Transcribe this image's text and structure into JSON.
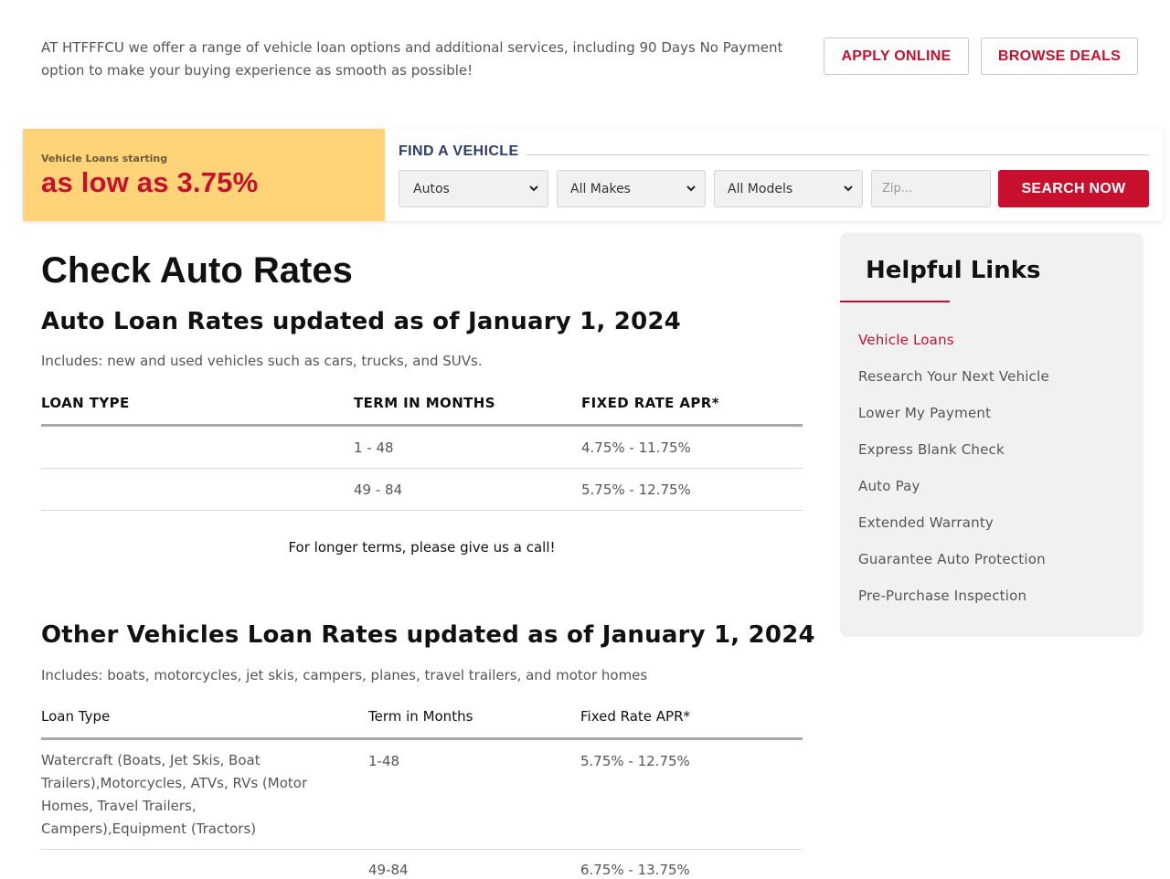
{
  "intro": {
    "text": "AT HTFFFCU we offer a range of vehicle loan options and additional services, including 90 Days No Payment option to make your buying experience as smooth as possible!",
    "apply_label": "APPLY ONLINE",
    "browse_label": "BROWSE DEALS"
  },
  "finder": {
    "promo_small": "Vehicle Loans starting",
    "promo_big": "as low as 3.75%",
    "title": "FIND A VEHICLE",
    "type_value": "Autos",
    "make_value": "All Makes",
    "model_value": "All Models",
    "zip_placeholder": "Zip...",
    "search_label": "SEARCH NOW"
  },
  "main": {
    "page_title": "Check Auto Rates",
    "auto": {
      "heading": "Auto Loan Rates updated as of January 1, 2024",
      "includes": "Includes: new and used vehicles such as cars, trucks, and SUVs.",
      "headers": [
        "LOAN TYPE",
        "TERM IN MONTHS",
        "FIXED RATE APR*"
      ],
      "rows": [
        {
          "type": "",
          "term": "1 - 48",
          "apr": "4.75% - 11.75%"
        },
        {
          "type": "",
          "term": "49 - 84",
          "apr": "5.75% - 12.75%"
        }
      ],
      "note": "For longer terms, please give us a call!"
    },
    "other": {
      "heading": "Other Vehicles Loan Rates updated as of January 1, 2024",
      "includes": "Includes: boats, motorcycles, jet skis, campers, planes, travel trailers, and motor homes",
      "headers": [
        "Loan Type",
        "Term in Months",
        "Fixed Rate APR*"
      ],
      "rows": [
        {
          "type": "Watercraft (Boats, Jet Skis, Boat Trailers),Motorcycles, ATVs, RVs (Motor Homes, Travel Trailers, Campers),Equipment (Tractors)",
          "term": "1-48",
          "apr": "5.75% - 12.75%"
        },
        {
          "type": "",
          "term": "49-84",
          "apr": "6.75% - 13.75%"
        }
      ]
    }
  },
  "sidebar": {
    "title": "Helpful Links",
    "links": [
      {
        "label": "Vehicle Loans"
      },
      {
        "label": "Research Your Next Vehicle"
      },
      {
        "label": "Lower My Payment"
      },
      {
        "label": "Express Blank Check"
      },
      {
        "label": "Auto Pay"
      },
      {
        "label": "Extended Warranty"
      },
      {
        "label": "Guarantee Auto Protection"
      },
      {
        "label": "Pre-Purchase Inspection"
      }
    ]
  },
  "colors": {
    "accent": "#c8102e",
    "promo_bg": "#ffd478",
    "find_title": "#2c3e6b"
  },
  "icons": [
    "chevron-down-icon"
  ]
}
